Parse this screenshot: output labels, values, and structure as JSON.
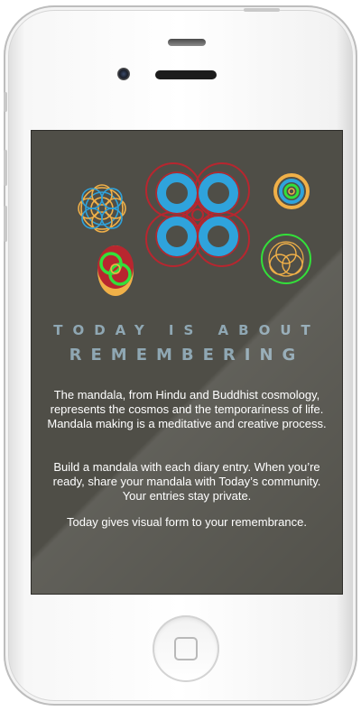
{
  "screen": {
    "heading_line1": "TODAY IS ABOUT",
    "heading_line2": "REMEMBERING",
    "paragraphs": [
      "The mandala, from Hindu and Buddhist cosmology, represents the cosmos and the temporariness of life. Mandala making is a meditative and creative process.",
      "Build a mandala with each diary entry. When you’re ready, share your mandala with Today’s community. Your entries stay private.",
      "Today gives visual form to your remembrance."
    ]
  },
  "colors": {
    "screen_bg": "#4f4e47",
    "heading": "#8fa7b3",
    "ring_blue": "#2fa3dc",
    "ring_red": "#b8262f",
    "ring_orange": "#f0b048",
    "ring_green": "#33e03a"
  },
  "icons": {
    "mandalas": [
      "flower-mandala-icon",
      "quad-ring-mandala-icon",
      "target-mandala-icon",
      "chain-mandala-icon",
      "triple-circle-mandala-icon"
    ]
  }
}
